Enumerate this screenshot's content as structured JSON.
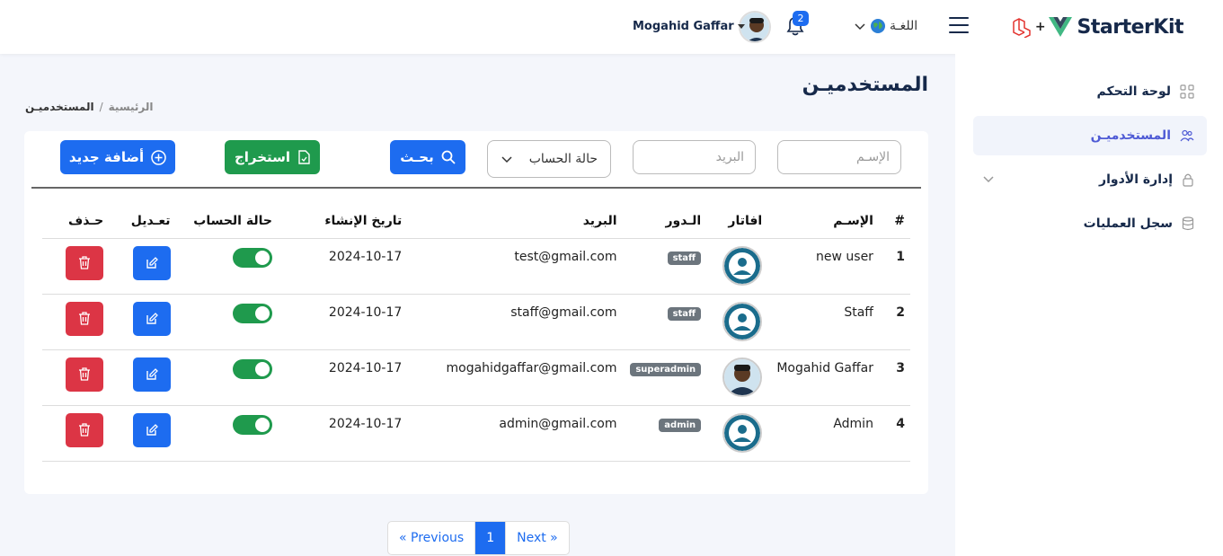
{
  "header": {
    "brand": "StarterKit",
    "language_label": "اللغـة",
    "notifications_count": "2",
    "user_name": "Mogahid Gaffar"
  },
  "sidebar": {
    "items": [
      {
        "label": "لوحة التحكم",
        "icon": "grid-icon"
      },
      {
        "label": "المستخدميـن",
        "icon": "users-icon"
      },
      {
        "label": "إدارة الأدوار",
        "icon": "lock-icon"
      },
      {
        "label": "سجل العمليات",
        "icon": "database-icon"
      }
    ]
  },
  "page": {
    "title": "المستخدميـن",
    "breadcrumb_home": "الرئيسية",
    "breadcrumb_sep": "/",
    "breadcrumb_current": "المستخدميـن"
  },
  "filters": {
    "name_placeholder": "الإسـم",
    "email_placeholder": "البريد",
    "status_select": "حالة الحساب",
    "search_label": "بحـث",
    "export_label": "استخراج",
    "add_label": "أضافة جديد"
  },
  "table": {
    "headers": [
      "#",
      "الإسـم",
      "افاتار",
      "الـدور",
      "البريد",
      "تاريخ الإنشاء",
      "حالة الحساب",
      "تعـديل",
      "حـذف"
    ],
    "rows": [
      {
        "num": "1",
        "name": "new user",
        "role": "staff",
        "email": "test@gmail.com",
        "created": "2024-10-17",
        "avatar": "default"
      },
      {
        "num": "2",
        "name": "Staff",
        "role": "staff",
        "email": "staff@gmail.com",
        "created": "2024-10-17",
        "avatar": "default"
      },
      {
        "num": "3",
        "name": "Mogahid Gaffar",
        "role": "superadmin",
        "email": "mogahidgaffar@gmail.com",
        "created": "2024-10-17",
        "avatar": "photo"
      },
      {
        "num": "4",
        "name": "Admin",
        "role": "admin",
        "email": "admin@gmail.com",
        "created": "2024-10-17",
        "avatar": "default"
      }
    ]
  },
  "pagination": {
    "prev": "« Previous",
    "current": "1",
    "next": "Next »"
  }
}
